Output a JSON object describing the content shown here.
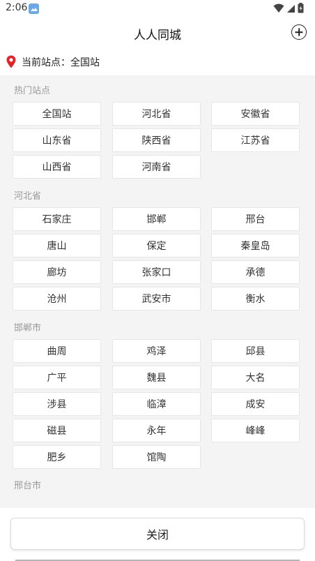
{
  "status_bar": {
    "time": "2:06"
  },
  "header": {
    "title": "人人同城"
  },
  "current_station": {
    "label": "当前站点：全国站"
  },
  "sections": [
    {
      "title": "热门站点",
      "items": [
        "全国站",
        "河北省",
        "安徽省",
        "山东省",
        "陕西省",
        "江苏省",
        "山西省",
        "河南省"
      ]
    },
    {
      "title": "河北省",
      "items": [
        "石家庄",
        "邯郸",
        "邢台",
        "唐山",
        "保定",
        "秦皇岛",
        "廊坊",
        "张家口",
        "承德",
        "沧州",
        "武安市",
        "衡水"
      ]
    },
    {
      "title": "邯郸市",
      "items": [
        "曲周",
        "鸡泽",
        "邱县",
        "广平",
        "魏县",
        "大名",
        "涉县",
        "临漳",
        "成安",
        "磁县",
        "永年",
        "峰峰",
        "肥乡",
        "馆陶"
      ]
    },
    {
      "title": "邢台市",
      "items": []
    }
  ],
  "footer": {
    "close_label": "关闭"
  },
  "colors": {
    "pin": "#e8202a",
    "panel_bg": "#f4f4f4",
    "section_title": "#999999"
  }
}
